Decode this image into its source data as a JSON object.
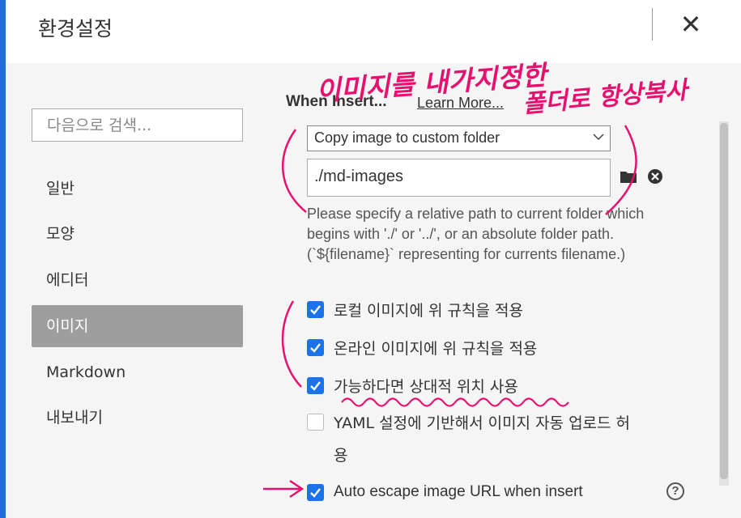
{
  "window": {
    "title": "환경설정",
    "close_label": "✕"
  },
  "sidebar": {
    "search_placeholder": "다음으로 검색...",
    "items": [
      {
        "label": "일반"
      },
      {
        "label": "모양"
      },
      {
        "label": "에디터"
      },
      {
        "label": "이미지",
        "active": true
      },
      {
        "label": "Markdown"
      },
      {
        "label": "내보내기"
      }
    ]
  },
  "main": {
    "section_title": "When Insert...",
    "learn_more": "Learn More...",
    "insert_action": {
      "selected": "Copy image to custom folder"
    },
    "folder_path": {
      "value": "./md-images"
    },
    "help_text": "Please specify a relative path to current folder which begins with './' or '../', or an absolute folder path. (`${filename}` representing for currents filename.)",
    "checkboxes": [
      {
        "label": "로컬 이미지에 위 규칙을 적용",
        "checked": true
      },
      {
        "label": "온라인 이미지에 위 규칙을 적용",
        "checked": true
      },
      {
        "label": "가능하다면 상대적 위치 사용",
        "checked": true
      },
      {
        "label": "YAML 설정에 기반해서 이미지 자동 업로드 허",
        "label_cont": "용",
        "checked": false
      },
      {
        "label": "Auto escape image URL when insert",
        "checked": true
      }
    ],
    "help_icon": "?"
  },
  "annotations": {
    "line1": "이미지를 내가지정한",
    "line2": "폴더로 항상복사",
    "color": "#e8106e"
  },
  "colors": {
    "accent": "#1a73e8",
    "sidebar_active": "#9e9e9e",
    "frame": "#1f6fd6"
  }
}
